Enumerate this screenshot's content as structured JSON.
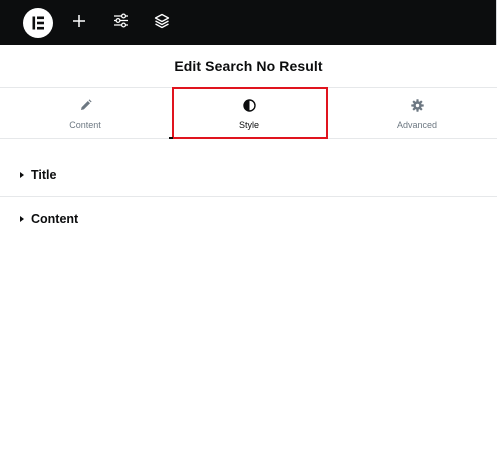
{
  "topbar": {
    "logo_icon": "elementor-logo-icon",
    "tools": [
      {
        "name": "add-element",
        "icon": "plus-icon"
      },
      {
        "name": "site-settings",
        "icon": "sliders-icon"
      },
      {
        "name": "structure",
        "icon": "layers-icon"
      }
    ]
  },
  "panel": {
    "title": "Edit Search No Result"
  },
  "tabs": [
    {
      "label": "Content",
      "icon": "pencil-icon",
      "active": false
    },
    {
      "label": "Style",
      "icon": "half-circle-contrast-icon",
      "active": true
    },
    {
      "label": "Advanced",
      "icon": "gear-icon",
      "active": false
    }
  ],
  "sections": [
    {
      "label": "Title",
      "expanded": false
    },
    {
      "label": "Content",
      "expanded": false
    }
  ],
  "colors": {
    "topbar_bg": "#0c0d0e",
    "highlight": "#e0141e",
    "muted_text": "#6d7882"
  }
}
